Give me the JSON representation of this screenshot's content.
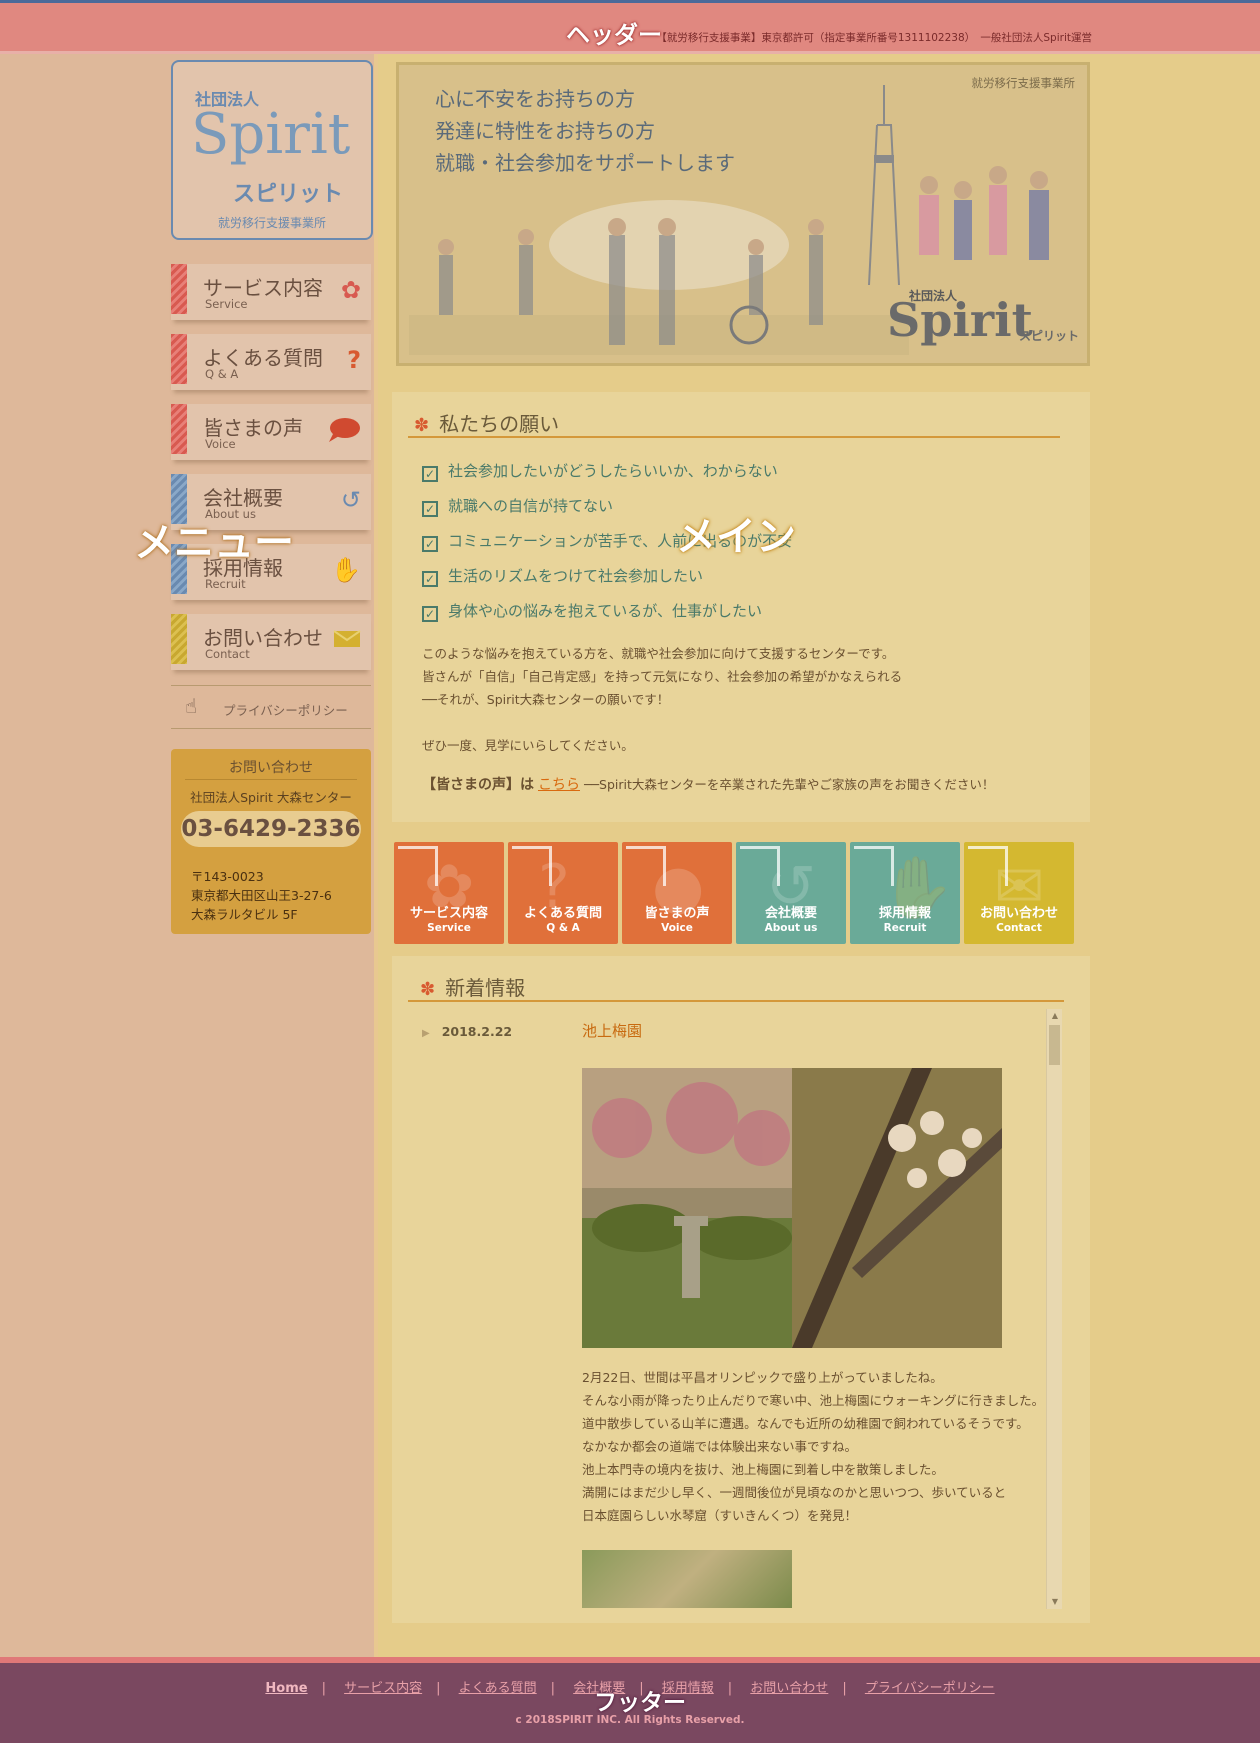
{
  "header": {
    "overlay_label": "ヘッダー",
    "note": "【就労移行支援事業】東京都許可（指定事業所番号1311102238）　一般社団法人Spirit運営"
  },
  "logo": {
    "org_type": "社団法人",
    "name": "Spirit",
    "kana": "スピリット",
    "footer": "就労移行支援事業所"
  },
  "menu": {
    "overlay_label": "メニュー",
    "items": [
      {
        "jp": "サービス内容",
        "en": "Service",
        "icon": "clover-icon"
      },
      {
        "jp": "よくある質問",
        "en": "Q & A",
        "icon": "question-icon"
      },
      {
        "jp": "皆さまの声",
        "en": "Voice",
        "icon": "speech-bubble-icon"
      },
      {
        "jp": "会社概要",
        "en": "About us",
        "icon": "swirl-icon"
      },
      {
        "jp": "採用情報",
        "en": "Recruit",
        "icon": "handshake-icon"
      },
      {
        "jp": "お問い合わせ",
        "en": "Contact",
        "icon": "envelope-icon"
      }
    ],
    "privacy": "プライバシーポリシー"
  },
  "contact": {
    "title": "お問い合わせ",
    "org": "社団法人Spirit 大森センター",
    "tel": "03-6429-2336",
    "zip": "〒143-0023",
    "address1": "東京都大田区山王3-27-6",
    "address2": "大森ラルタビル 5F"
  },
  "hero": {
    "lines": [
      "心に不安をお持ちの方",
      "発達に特性をお持ちの方",
      "就職・社会参加をサポートします"
    ],
    "tag": "就労移行支援事業所",
    "brand_sub": "社団法人",
    "brand": "Spirit",
    "brand_kana": "スピリット"
  },
  "main": {
    "overlay_label": "メイン"
  },
  "wish": {
    "title": "私たちの願い",
    "checks": [
      "社会参加したいがどうしたらいいか、わからない",
      "就職への自信が持てない",
      "コミュニケーションが苦手で、人前に出るのが不安",
      "生活のリズムをつけて社会参加したい",
      "身体や心の悩みを抱えているが、仕事がしたい"
    ],
    "para1": "このような悩みを抱えている方を、就職や社会参加に向けて支援するセンターです。",
    "para2": "皆さんが「自信」「自己肯定感」を持って元気になり、社会参加の希望がかなえられる",
    "para3": "──それが、Spirit大森センターの願いです！",
    "para4": "ぜひ一度、見学にいらしてください。",
    "voice_label": "【皆さまの声】は",
    "voice_link": "こちら",
    "voice_tail": "──Spirit大森センターを卒業された先輩やご家族の声をお聞きください！"
  },
  "tiles": [
    {
      "jp": "サービス内容",
      "en": "Service",
      "color": "#e0703a"
    },
    {
      "jp": "よくある質問",
      "en": "Q & A",
      "color": "#e0703a"
    },
    {
      "jp": "皆さまの声",
      "en": "Voice",
      "color": "#e0703a"
    },
    {
      "jp": "会社概要",
      "en": "About us",
      "color": "#6aaa98"
    },
    {
      "jp": "採用情報",
      "en": "Recruit",
      "color": "#6aaa98"
    },
    {
      "jp": "お問い合わせ",
      "en": "Contact",
      "color": "#d4b830"
    }
  ],
  "news": {
    "title": "新着情報",
    "date": "2018.2.22",
    "post_title": "池上梅園",
    "body": [
      "2月22日、世間は平昌オリンピックで盛り上がっていましたね。",
      "そんな小雨が降ったり止んだりで寒い中、池上梅園にウォーキングに行きました。",
      "道中散歩している山羊に遭遇。なんでも近所の幼稚園で飼われているそうです。",
      "なかなか都会の道端では体験出来ない事ですね。",
      "池上本門寺の境内を抜け、池上梅園に到着し中を散策しました。",
      "満開にはまだ少し早く、一週間後位が見頃なのかと思いつつ、歩いていると",
      "日本庭園らしい水琴窟（すいきんくつ）を発見！"
    ]
  },
  "footer": {
    "overlay_label": "フッター",
    "links": [
      "Home",
      "サービス内容",
      "よくある質問",
      "会社概要",
      "採用情報",
      "お問い合わせ",
      "プライバシーポリシー"
    ],
    "copyright": "c 2018SPIRIT INC. All Rights Reserved."
  },
  "colors": {
    "header": "#e08880",
    "menu_panel": "#deb89a",
    "main_panel": "#e5cc8a",
    "footer": "#7a4860",
    "accent_orange": "#d4983a"
  }
}
